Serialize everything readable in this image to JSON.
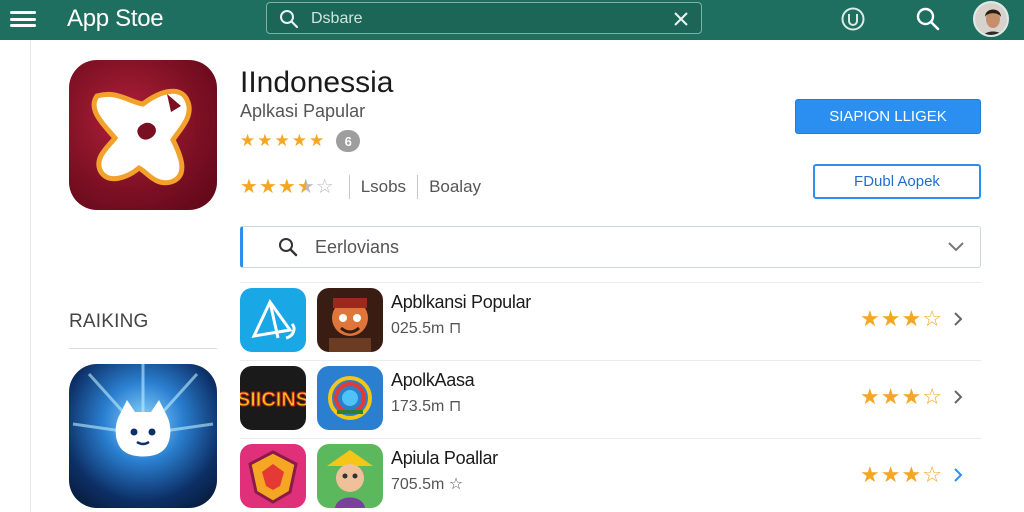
{
  "topbar": {
    "brand": "App Stoe",
    "search_placeholder": "Dsbare",
    "bg_color": "#1e6f5f"
  },
  "app": {
    "title": "IIndonessia",
    "subtitle": "Aplkasi Papular",
    "rating_top_stars": 5,
    "badge": "6",
    "rating_bottom_stars": 3.5,
    "meta": [
      "Lsobs",
      "Boalay"
    ],
    "primary_button": "SIAPION LLIGEK",
    "secondary_button": "FDubl Aopek"
  },
  "filter": {
    "label": "Eerlovians"
  },
  "ranking": {
    "title": "RAIKING"
  },
  "list": [
    {
      "name": "Apblkansi Popular",
      "size": "025.5m",
      "size_icon": "bookmark-icon",
      "rating": 3.5
    },
    {
      "name": "ApolkAasa",
      "size": "173.5m",
      "size_icon": "bookmark-icon",
      "rating": 3.5
    },
    {
      "name": "Apiula Poallar",
      "size": "705.5m",
      "size_icon": "star-icon",
      "rating": 3.5
    }
  ],
  "thumbs": {
    "row3_a_label": "SIICINS"
  },
  "colors": {
    "accent": "#2a8ff0",
    "star": "#f5a623"
  }
}
